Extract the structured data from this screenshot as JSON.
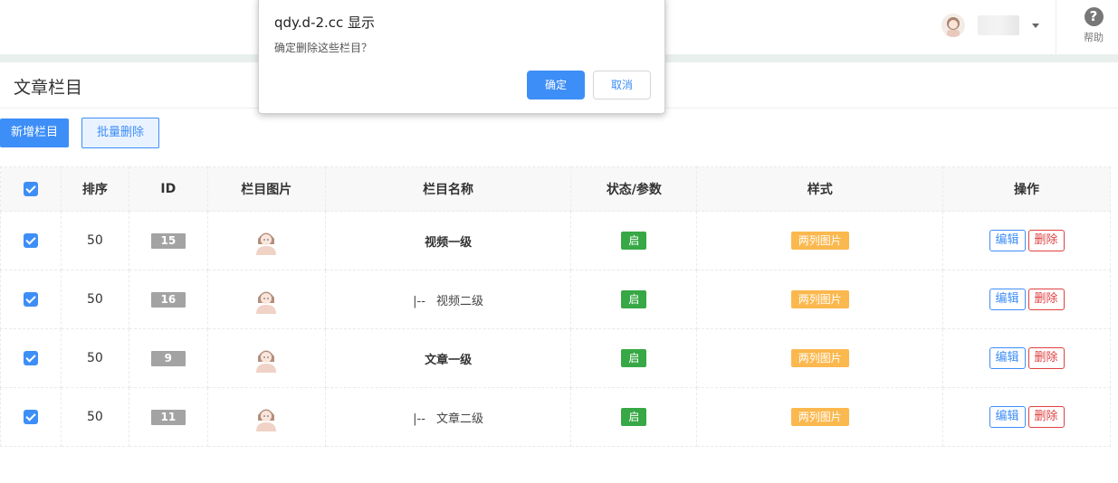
{
  "header": {
    "help_label": "帮助",
    "help_glyph": "?"
  },
  "page": {
    "title": "文章栏目",
    "add_button": "新增栏目",
    "batch_delete_button": "批量删除"
  },
  "table": {
    "columns": [
      "",
      "排序",
      "ID",
      "栏目图片",
      "栏目名称",
      "状态/参数",
      "样式",
      "操作"
    ],
    "rows": [
      {
        "checked": true,
        "sort": "50",
        "id": "15",
        "name": "视频一级",
        "prefix": "",
        "status": "启",
        "style": "两列图片",
        "edit": "编辑",
        "delete": "删除"
      },
      {
        "checked": true,
        "sort": "50",
        "id": "16",
        "name": "视频二级",
        "prefix": "|--",
        "status": "启",
        "style": "两列图片",
        "edit": "编辑",
        "delete": "删除"
      },
      {
        "checked": true,
        "sort": "50",
        "id": "9",
        "name": "文章一级",
        "prefix": "",
        "status": "启",
        "style": "两列图片",
        "edit": "编辑",
        "delete": "删除"
      },
      {
        "checked": true,
        "sort": "50",
        "id": "11",
        "name": "文章二级",
        "prefix": "|--",
        "status": "启",
        "style": "两列图片",
        "edit": "编辑",
        "delete": "删除"
      }
    ]
  },
  "dialog": {
    "title": "qdy.d-2.cc 显示",
    "message": "确定删除这些栏目？",
    "ok": "确定",
    "cancel": "取消"
  },
  "colors": {
    "primary": "#3e8ef7",
    "status_on": "#37a845",
    "style_badge": "#fbb84e",
    "danger": "#e04040",
    "id_badge": "#a3a3a3"
  }
}
